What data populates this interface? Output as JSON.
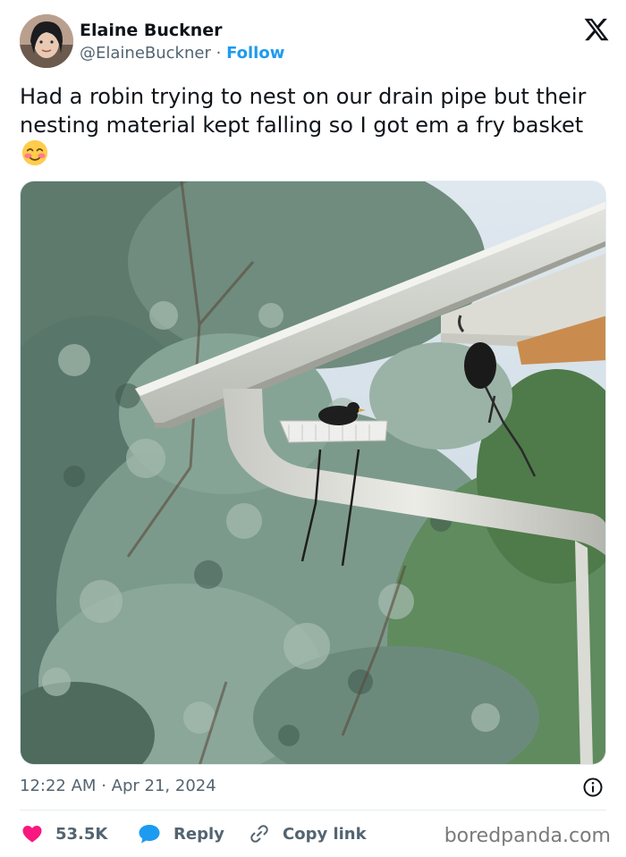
{
  "tweet": {
    "author_name": "Elaine Buckner",
    "handle": "@ElaineBuckner",
    "separator": "·",
    "follow_label": "Follow",
    "text": "Had a robin trying to nest on our drain pipe but their nesting material kept falling so I got em a fry basket",
    "emoji": "smiling-face-with-rosy-cheeks",
    "time": "12:22 AM",
    "date_separator": "·",
    "date": "Apr 21, 2024"
  },
  "actions": {
    "likes": "53.5K",
    "reply_label": "Reply",
    "copy_link_label": "Copy link"
  },
  "watermark": "boredpanda.com",
  "icons": {
    "brand": "x-logo-icon",
    "info": "info-icon",
    "like": "heart-icon",
    "reply": "reply-bubble-icon",
    "copy": "link-icon"
  },
  "colors": {
    "follow": "#1d9bf0",
    "like": "#f91880",
    "reply": "#1d9bf0",
    "muted": "#536471"
  }
}
